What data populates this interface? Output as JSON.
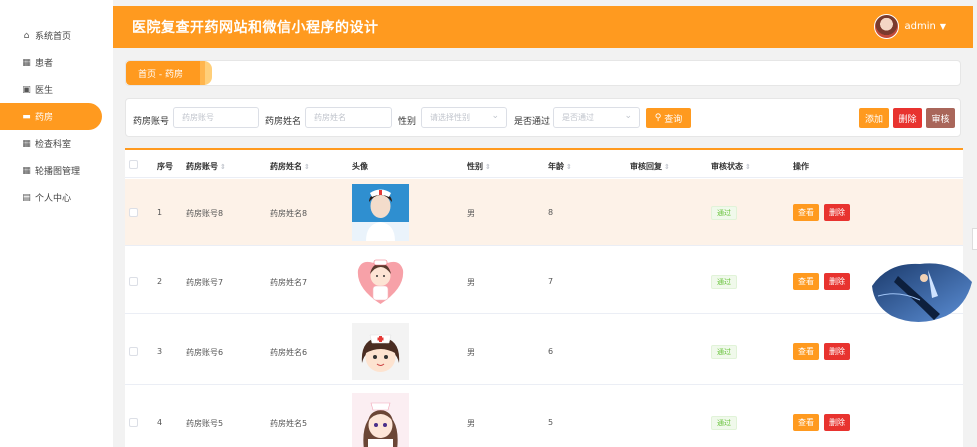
{
  "header": {
    "title": "医院复查开药网站和微信小程序的设计",
    "username": "admin",
    "caret": "▼"
  },
  "sidebar": {
    "items": [
      {
        "label": "系统首页",
        "icon": "home-icon",
        "glyph": "⌂"
      },
      {
        "label": "患者",
        "icon": "grid-icon",
        "glyph": "▦"
      },
      {
        "label": "医生",
        "icon": "checkbox-icon",
        "glyph": "▣"
      },
      {
        "label": "药房",
        "icon": "briefcase-icon",
        "glyph": "▬"
      },
      {
        "label": "检查科室",
        "icon": "table-icon",
        "glyph": "▦"
      },
      {
        "label": "轮播图管理",
        "icon": "grid-icon",
        "glyph": "▦"
      },
      {
        "label": "个人中心",
        "icon": "id-card-icon",
        "glyph": "▤"
      }
    ],
    "active_index": 3
  },
  "breadcrumb": {
    "text": "首页 - 药房"
  },
  "search": {
    "fields": [
      {
        "label": "药房账号",
        "placeholder": "药房账号"
      },
      {
        "label": "药房姓名",
        "placeholder": "药房姓名"
      },
      {
        "label": "性别",
        "placeholder": "请选择性别"
      },
      {
        "label": "是否通过",
        "placeholder": "是否通过"
      }
    ],
    "search_button": "查询",
    "add_button": "添加",
    "delete_button": "删除",
    "audit_button": "审核"
  },
  "table": {
    "columns": [
      "序号",
      "药房账号",
      "药房姓名",
      "头像",
      "性别",
      "年龄",
      "审核回复",
      "审核状态",
      "操作"
    ],
    "sortable": [
      false,
      true,
      true,
      false,
      true,
      true,
      true,
      true,
      false
    ],
    "rows": [
      {
        "index": "1",
        "account": "药房账号8",
        "name": "药房姓名8",
        "avatar": "nurse-photo",
        "gender": "男",
        "age": "8",
        "reply": "",
        "status": "通过"
      },
      {
        "index": "2",
        "account": "药房账号7",
        "name": "药房姓名7",
        "avatar": "nurse-heart-cartoon",
        "gender": "男",
        "age": "7",
        "reply": "",
        "status": "通过"
      },
      {
        "index": "3",
        "account": "药房账号6",
        "name": "药房姓名6",
        "avatar": "nurse-cartoon",
        "gender": "男",
        "age": "6",
        "reply": "",
        "status": "通过"
      },
      {
        "index": "4",
        "account": "药房账号5",
        "name": "药房姓名5",
        "avatar": "nurse-anime",
        "gender": "男",
        "age": "5",
        "reply": "",
        "status": "通过"
      }
    ],
    "view_button": "查看",
    "delete_button": "删除"
  },
  "colors": {
    "accent": "#ff9a1f",
    "danger": "#e8332f",
    "audit": "#a9665a",
    "success": "#67c23a"
  }
}
